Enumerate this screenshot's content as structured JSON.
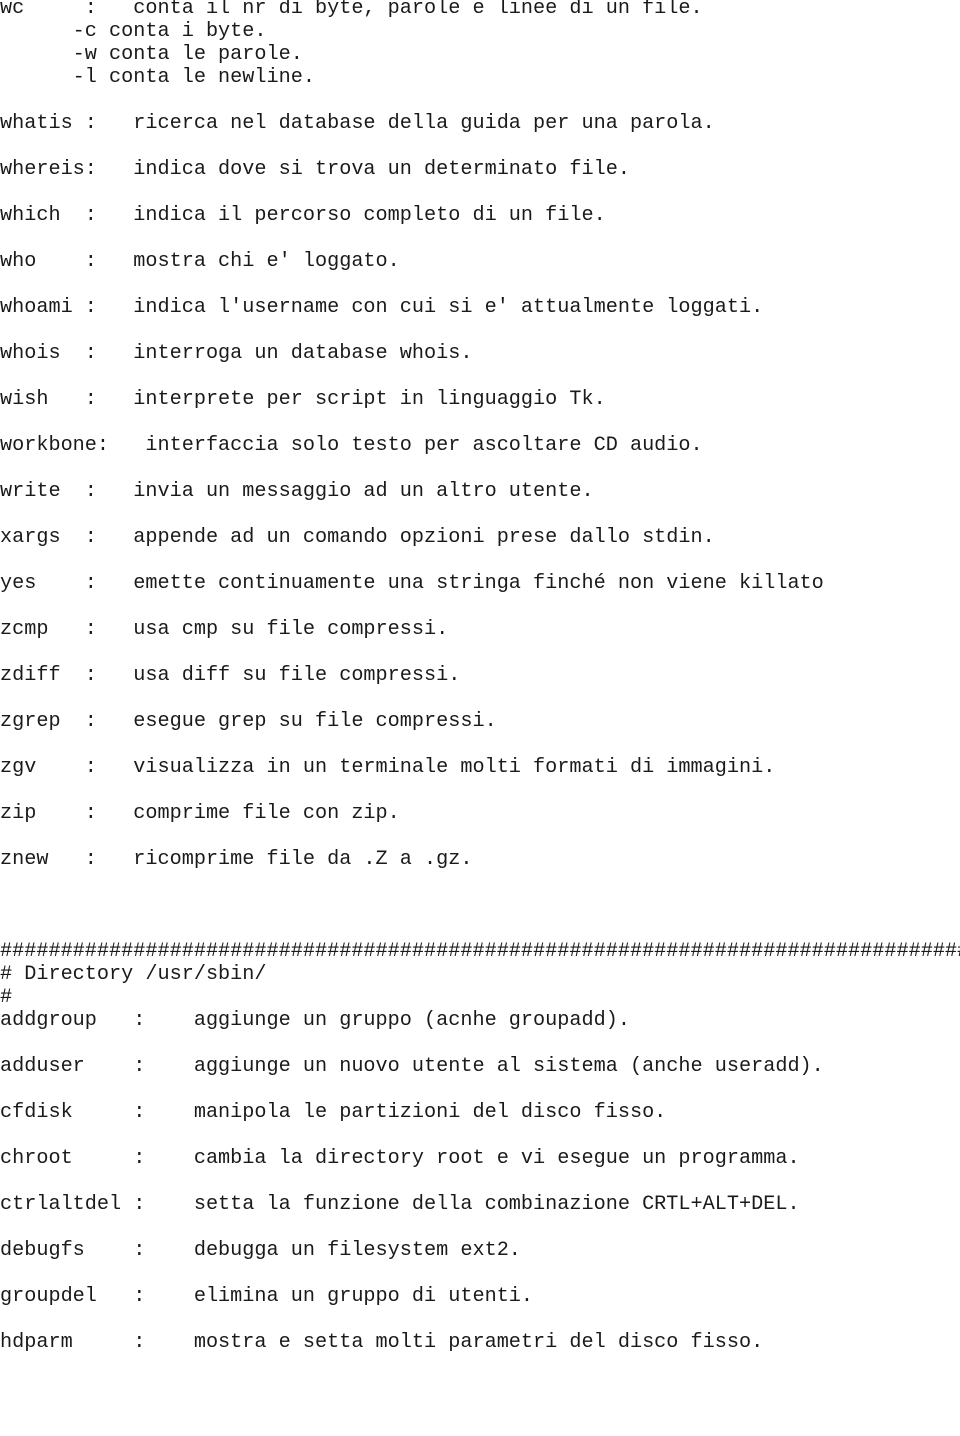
{
  "document": {
    "kind": "plain-text-command-reference",
    "language": "it",
    "font_style": "monospace",
    "text_color": "#1a1a1a",
    "background_color": "#ffffff",
    "section_bin_entries": [
      {
        "command": "wc",
        "separator": ":",
        "description": "conta il nr di byte, parole e linee di un file.",
        "options": [
          "-c conta i byte.",
          "-w conta le parole.",
          "-l conta le newline."
        ]
      },
      {
        "command": "whatis",
        "separator": ":",
        "description": "ricerca nel database della guida per una parola.",
        "options": []
      },
      {
        "command": "whereis",
        "separator": ":",
        "description": "indica dove si trova un determinato file.",
        "options": []
      },
      {
        "command": "which",
        "separator": ":",
        "description": "indica il percorso completo di un file.",
        "options": []
      },
      {
        "command": "who",
        "separator": ":",
        "description": "mostra chi e' loggato.",
        "options": []
      },
      {
        "command": "whoami",
        "separator": ":",
        "description": "indica l'username con cui si e' attualmente loggati.",
        "options": []
      },
      {
        "command": "whois",
        "separator": ":",
        "description": "interroga un database whois.",
        "options": []
      },
      {
        "command": "wish",
        "separator": ":",
        "description": "interprete per script in linguaggio Tk.",
        "options": []
      },
      {
        "command": "workbone",
        "separator": ":",
        "description": "interfaccia solo testo per ascoltare CD audio.",
        "options": []
      },
      {
        "command": "write",
        "separator": ":",
        "description": "invia un messaggio ad un altro utente.",
        "options": []
      },
      {
        "command": "xargs",
        "separator": ":",
        "description": "appende ad un comando opzioni prese dallo stdin.",
        "options": []
      },
      {
        "command": "yes",
        "separator": ":",
        "description": "emette continuamente una stringa finché non viene killato",
        "options": []
      },
      {
        "command": "zcmp",
        "separator": ":",
        "description": "usa cmp su file compressi.",
        "options": []
      },
      {
        "command": "zdiff",
        "separator": ":",
        "description": "usa diff su file compressi.",
        "options": []
      },
      {
        "command": "zgrep",
        "separator": ":",
        "description": "esegue grep su file compressi.",
        "options": []
      },
      {
        "command": "zgv",
        "separator": ":",
        "description": "visualizza in un terminale molti formati di immagini.",
        "options": []
      },
      {
        "command": "zip",
        "separator": ":",
        "description": "comprime file con zip.",
        "options": []
      },
      {
        "command": "znew",
        "separator": ":",
        "description": "ricomprime file da .Z a .gz.",
        "options": []
      }
    ],
    "section_header": {
      "rule": "################################################################################",
      "title_line": "# Directory /usr/sbin/",
      "trailing_line": "#"
    },
    "section_sbin_entries": [
      {
        "command": "addgroup",
        "separator": ":",
        "description": "aggiunge un gruppo (acnhe groupadd)."
      },
      {
        "command": "adduser",
        "separator": ":",
        "description": "aggiunge un nuovo utente al sistema (anche useradd)."
      },
      {
        "command": "cfdisk",
        "separator": ":",
        "description": "manipola le partizioni del disco fisso."
      },
      {
        "command": "chroot",
        "separator": ":",
        "description": "cambia la directory root e vi esegue un programma."
      },
      {
        "command": "ctrlaltdel",
        "separator": ":",
        "description": "setta la funzione della combinazione CRTL+ALT+DEL."
      },
      {
        "command": "debugfs",
        "separator": ":",
        "description": "debugga un filesystem ext2."
      },
      {
        "command": "groupdel",
        "separator": ":",
        "description": "elimina un gruppo di utenti."
      },
      {
        "command": "hdparm",
        "separator": ":",
        "description": "mostra e setta molti parametri del disco fisso."
      }
    ]
  }
}
